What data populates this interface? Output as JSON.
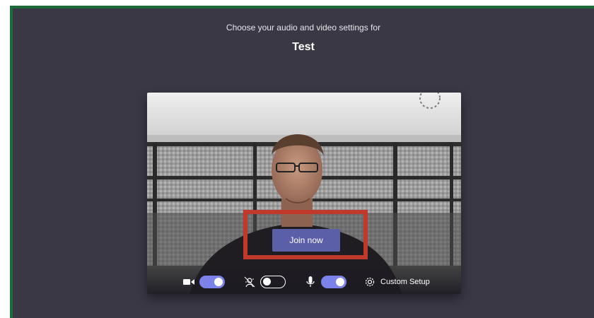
{
  "header": {
    "subtitle": "Choose your audio and video settings for",
    "meeting_title": "Test"
  },
  "join": {
    "label": "Join now"
  },
  "toolbar": {
    "camera": {
      "icon": "video-camera-icon",
      "toggle_on": true
    },
    "background_blur": {
      "icon": "background-blur-icon",
      "toggle_on": false
    },
    "microphone": {
      "icon": "microphone-icon",
      "toggle_on": true
    },
    "custom_setup": {
      "icon": "gear-icon",
      "label": "Custom Setup"
    }
  },
  "colors": {
    "frame_green": "#1e6a3a",
    "stage_background": "#3a3845",
    "toggle_on": "#7b83eb",
    "join_button": "#5b5fa8",
    "highlight_box": "#c0392b"
  }
}
